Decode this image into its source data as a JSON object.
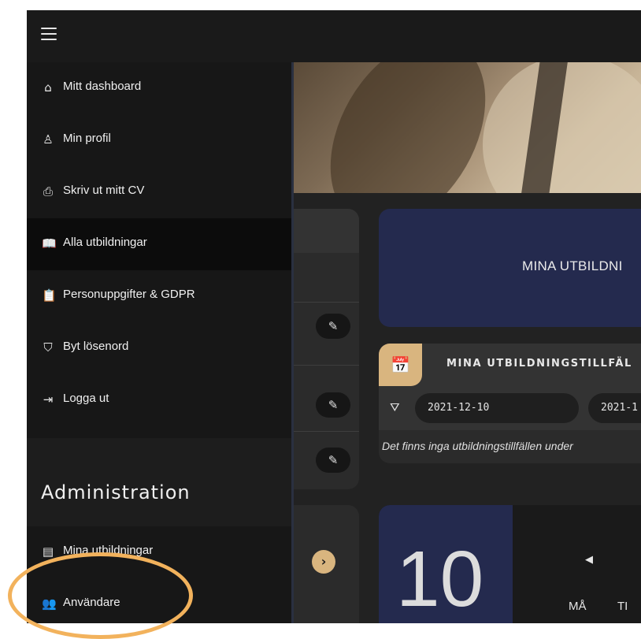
{
  "sidebar": {
    "items": [
      {
        "label": "Mitt dashboard",
        "icon": "home-icon"
      },
      {
        "label": "Min profil",
        "icon": "user-icon"
      },
      {
        "label": "Skriv ut mitt CV",
        "icon": "printer-icon"
      },
      {
        "label": "Alla utbildningar",
        "icon": "book-icon",
        "active": true
      },
      {
        "label": "Personuppgifter & GDPR",
        "icon": "clipboard-icon"
      },
      {
        "label": "Byt lösenord",
        "icon": "shield-icon"
      },
      {
        "label": "Logga ut",
        "icon": "logout-icon"
      }
    ],
    "admin_title": "Administration",
    "admin_items": [
      {
        "label": "Mina utbildningar",
        "icon": "book-list-icon"
      },
      {
        "label": "Användare",
        "icon": "users-icon"
      }
    ]
  },
  "main": {
    "educations_card_title": "MINA UTBILDNI",
    "sessions": {
      "title": "MINA UTBILDNINGSTILLFÄL",
      "date_from": "2021-12-10",
      "date_to": "2021-1",
      "empty_message": "Det finns inga utbildningstillfällen under"
    },
    "calendar": {
      "day": "10",
      "weekdays": [
        "MÅ",
        "TI"
      ]
    }
  },
  "colors": {
    "accent": "#d9b57f",
    "navy": "#242a4e",
    "highlight": "#f2b25c"
  }
}
